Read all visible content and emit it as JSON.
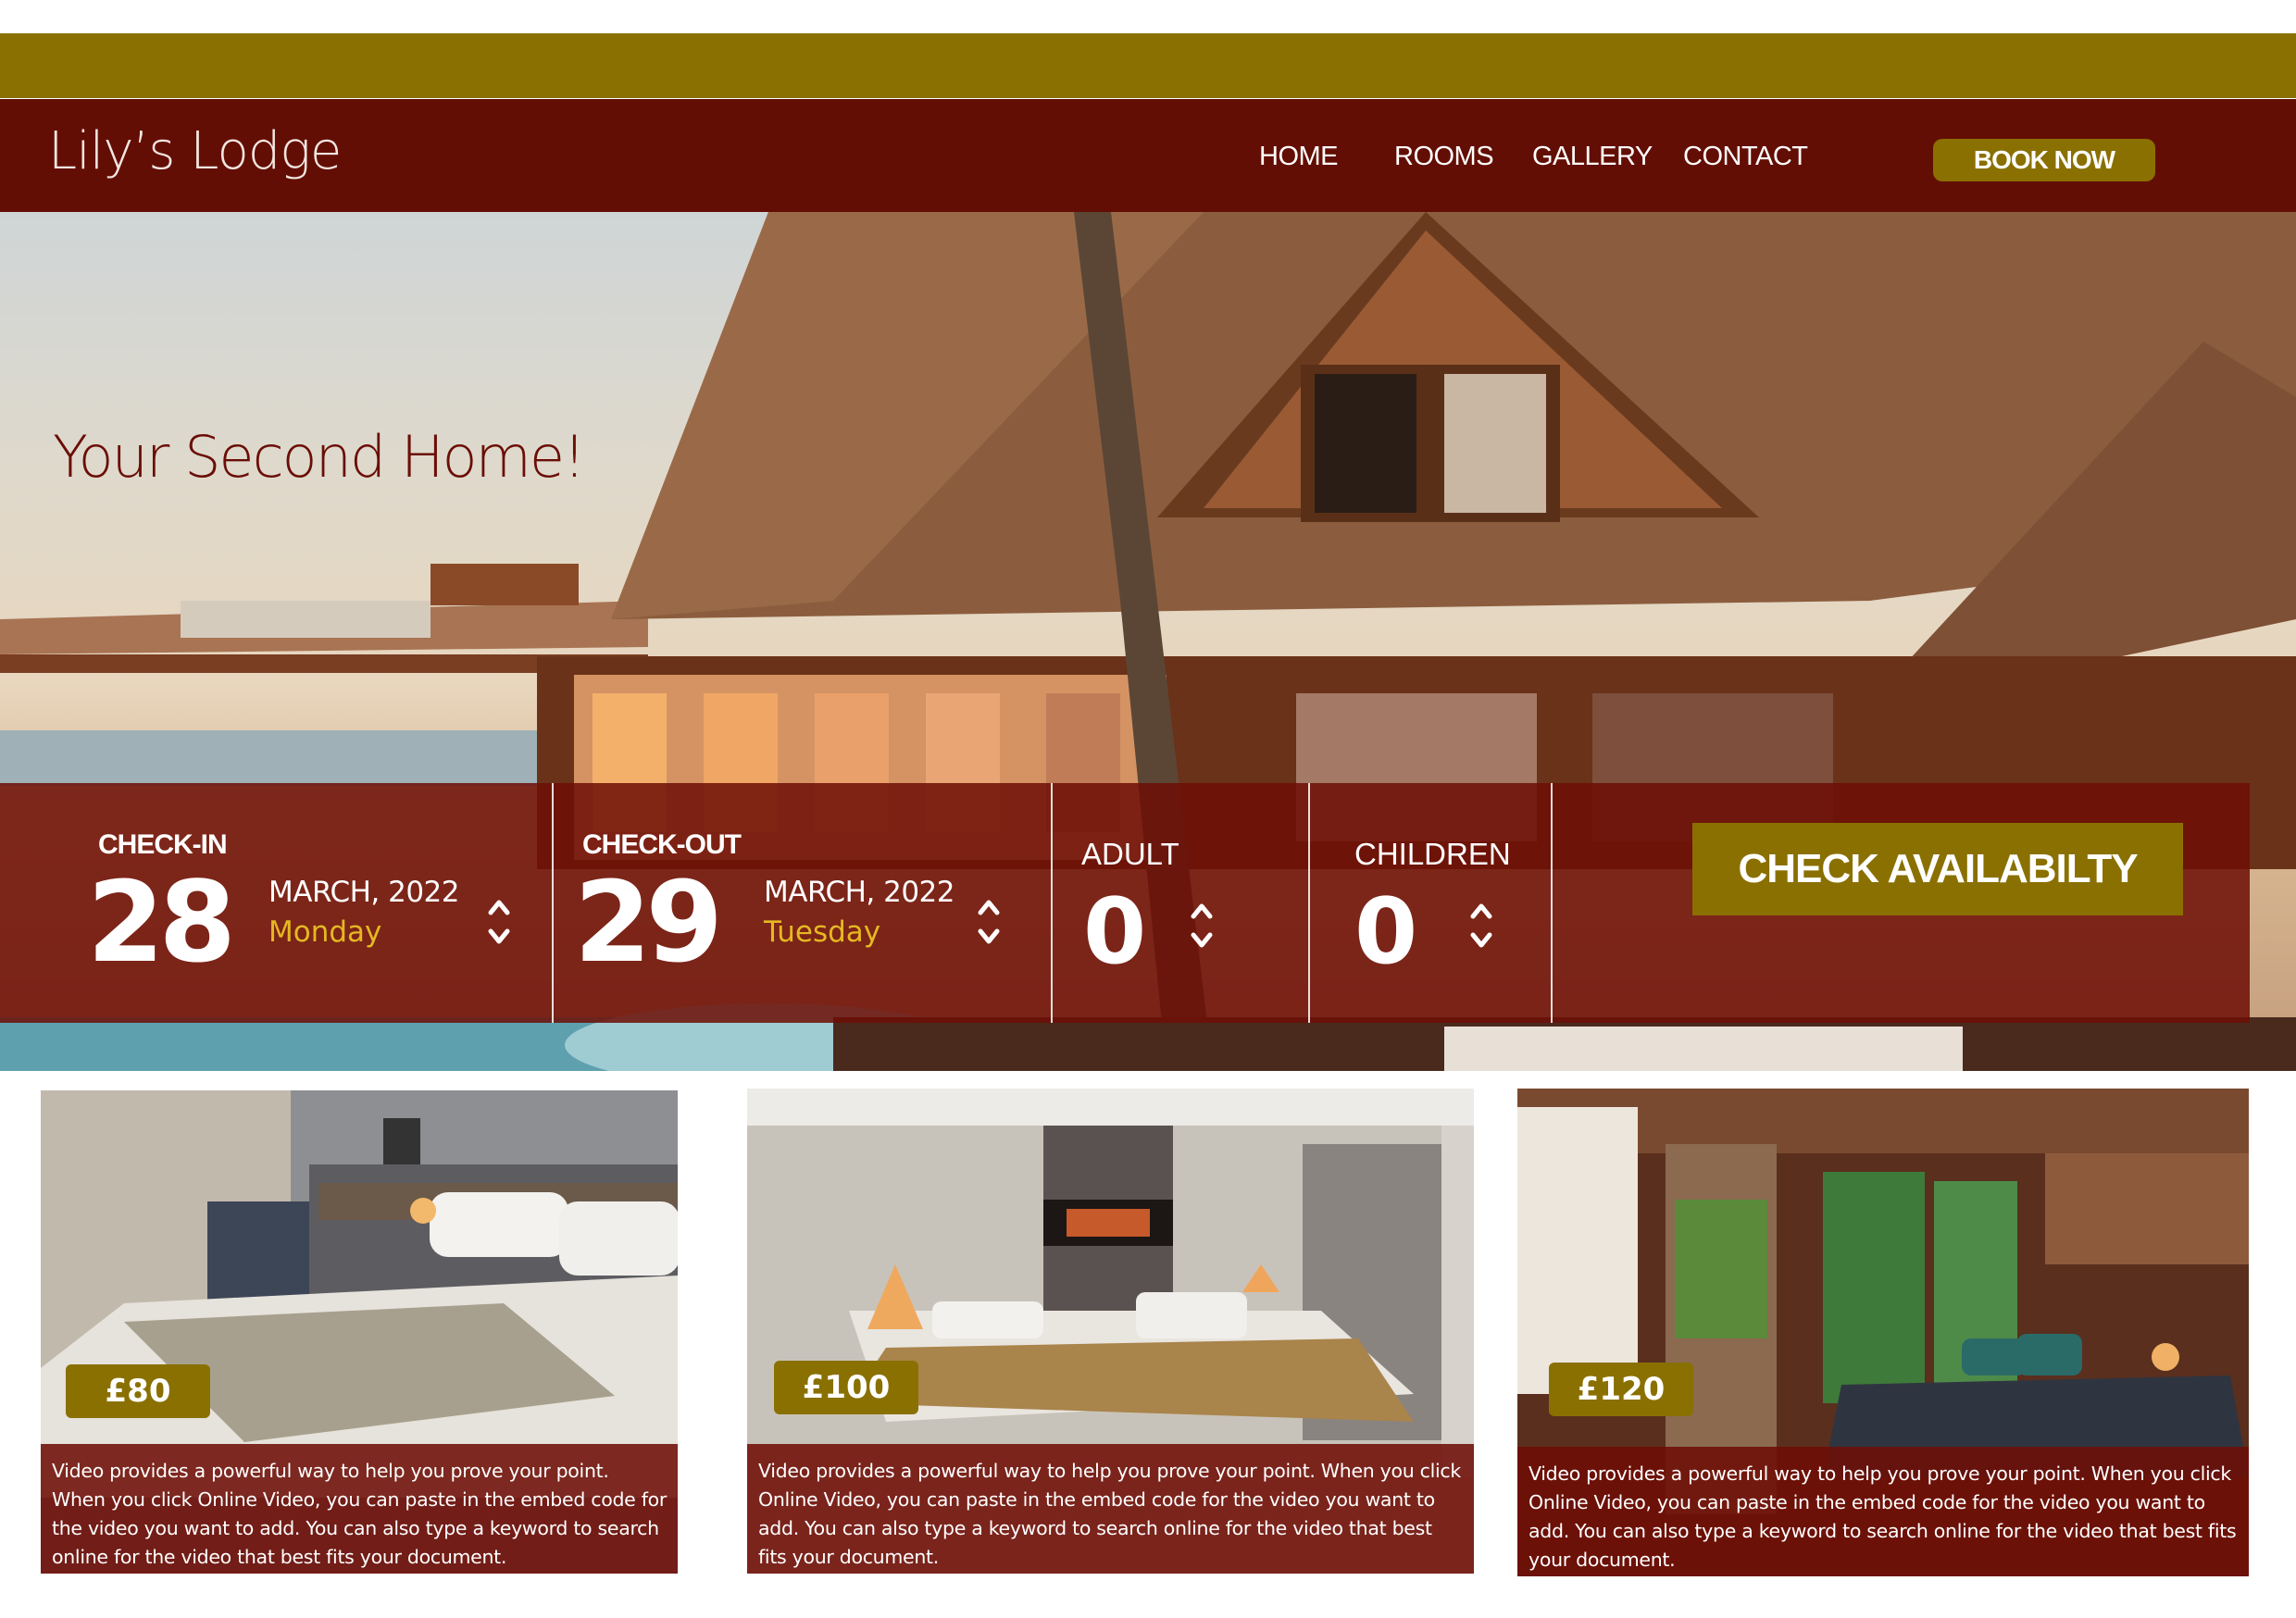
{
  "brand": {
    "logo": "Lily’s Lodge"
  },
  "nav": {
    "items": [
      "HOME",
      "ROOMS",
      "GALLERY",
      "CONTACT"
    ],
    "book_label": "BOOK NOW"
  },
  "hero": {
    "tagline": "Your Second Home!"
  },
  "booking": {
    "checkin": {
      "label": "CHECK-IN",
      "day_num": "28",
      "month": "MARCH, 2022",
      "weekday": "Monday"
    },
    "checkout": {
      "label": "CHECK-OUT",
      "day_num": "29",
      "month": "MARCH, 2022",
      "weekday": "Tuesday"
    },
    "adult": {
      "label": "ADULT",
      "value": "0"
    },
    "children": {
      "label": "CHILDREN",
      "value": "0"
    },
    "button_label": "CHECK AVAILABILTY"
  },
  "rooms": [
    {
      "price": "£80",
      "description": "Video provides a powerful way to help you prove your point. When you click Online Video, you can paste in the embed code for the video you want to add. You can also type a keyword to search online for the video that best fits your document."
    },
    {
      "price": "£100",
      "description": "Video provides a powerful way to help you prove your point. When you click Online Video, you can paste in the embed code for the video you want to add. You can also type a keyword to search online for the video that best fits your document."
    },
    {
      "price": "£120",
      "description": "Video provides a powerful way to help you prove your point. When you click Online Video, you can paste in the embed code for the video you want to add. You can also type a keyword to search online for the video that best fits your document."
    }
  ],
  "colors": {
    "olive": "#8a7001",
    "maroon": "#630e04",
    "gold_text": "#e5b822"
  },
  "icons": {
    "stepper": "up-down-chevron-icon"
  }
}
